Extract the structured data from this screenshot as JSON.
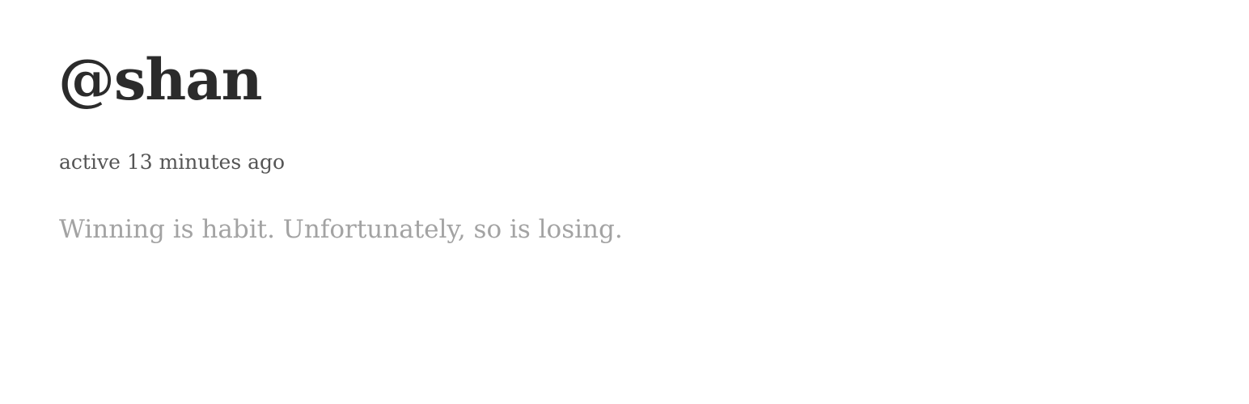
{
  "profile": {
    "username": "@shan",
    "activity": "active 13 minutes ago",
    "bio": "Winning is habit. Unfortunately, so is losing."
  },
  "colors": {
    "background": "#ffffff",
    "username": "#2b2b2b",
    "activity": "#555555",
    "bio": "#a3a3a3"
  }
}
